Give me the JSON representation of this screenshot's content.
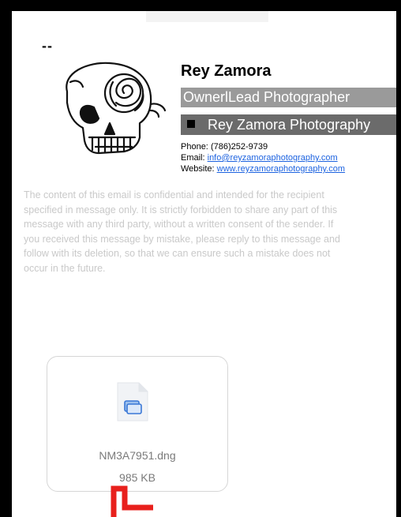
{
  "divider": "--",
  "signature": {
    "name": "Rey Zamora",
    "role": "OwnerlLead Photographer",
    "studio": "Rey Zamora Photography",
    "phone_label": "Phone:",
    "phone": "(786)252-9739",
    "email_label": "Email:",
    "email": "info@reyzamoraphotography.com",
    "website_label": "Website:",
    "website": "www.reyzamoraphotography.com"
  },
  "disclaimer_lines": [
    "The content of this email is confidential and intended for the recipient",
    "specified in message only. It is strictly forbidden to share any part of this",
    "message with any third party, without a written consent of the sender. If",
    "you received this message by mistake, please reply to this message and",
    "follow with its deletion, so that we can ensure such a mistake does not",
    "occur in the future."
  ],
  "attachment": {
    "file_name": "NM3A7951.dng",
    "file_size": "985 KB",
    "icon": "image-file-icon"
  },
  "colors": {
    "frame": "#000000",
    "role_bar": "#9a9a9a",
    "studio_bar": "#6b6b6b",
    "link": "#1d63e0",
    "annotation": "#e8201c",
    "file_icon_accent": "#3a78d6"
  }
}
